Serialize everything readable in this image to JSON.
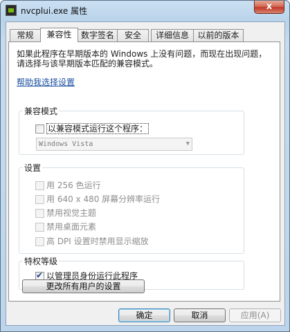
{
  "window": {
    "title": "nvcplui.exe 属性",
    "close_glyph": "x"
  },
  "tabs": [
    "常规",
    "兼容性",
    "数字签名",
    "安全",
    "详细信息",
    "以前的版本"
  ],
  "active_tab": "兼容性",
  "compat": {
    "intro": "如果此程序在早期版本的 Windows 上没有问题，而现在出现问题，请选择与该早期版本匹配的兼容模式。",
    "help_link": "帮助我选择设置",
    "mode_group": "兼容模式",
    "mode_checkbox": "以兼容模式运行这个程序：",
    "mode_checked": false,
    "os_select": "Windows Vista",
    "settings_group": "设置",
    "settings": [
      {
        "label": "用 256 色运行",
        "checked": false
      },
      {
        "label": "用 640 x 480 屏幕分辨率运行",
        "checked": false
      },
      {
        "label": "禁用视觉主题",
        "checked": false
      },
      {
        "label": "禁用桌面元素",
        "checked": false
      },
      {
        "label": "高 DPI 设置时禁用显示缩放",
        "checked": false
      }
    ],
    "privilege_group": "特权等级",
    "admin_checkbox": "以管理员身份运行此程序",
    "admin_checked": true,
    "all_users_button": "更改所有用户的设置"
  },
  "footer": {
    "ok": "确定",
    "cancel": "取消",
    "apply": "应用(A)"
  },
  "colors": {
    "titlebar": "#bcd5ec",
    "close_button": "#c0392b",
    "link": "#1a4fa0",
    "check": "#1c3f8f"
  }
}
